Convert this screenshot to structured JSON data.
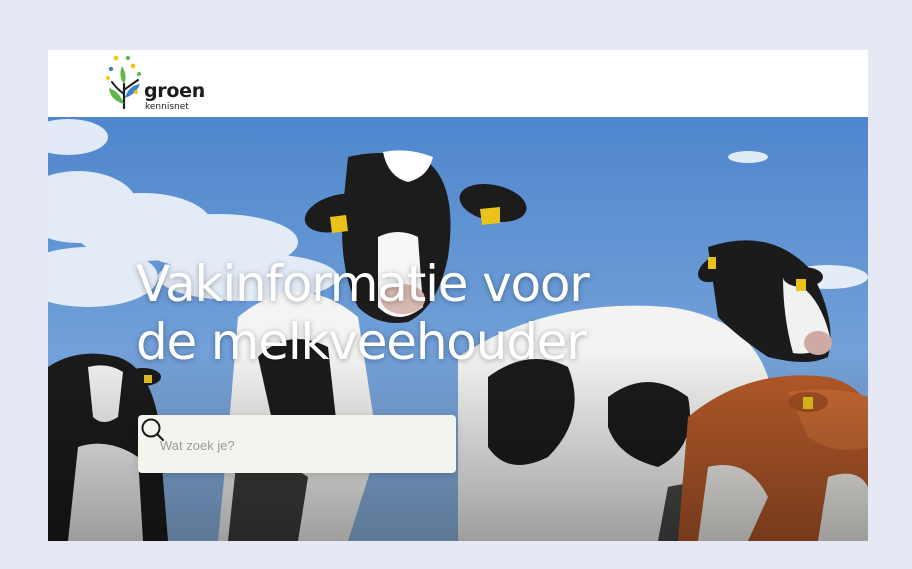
{
  "logo": {
    "name": "groen",
    "sub": "kennisnet",
    "colors": {
      "yellow": "#f6c21b",
      "green": "#5fb84a",
      "blue": "#3c7fc8",
      "dark": "#1c1c1c"
    }
  },
  "hero": {
    "headline_line1": "Vakinformatie voor",
    "headline_line2": "de melkveehouder",
    "image_subject": "dairy cows against blue sky"
  },
  "search": {
    "placeholder": "Wat zoek je?",
    "icon": "search-icon"
  },
  "colors": {
    "page_bg": "#e6e9f4",
    "sky": "#5b8fd0",
    "search_bg": "#f2f4ee"
  }
}
